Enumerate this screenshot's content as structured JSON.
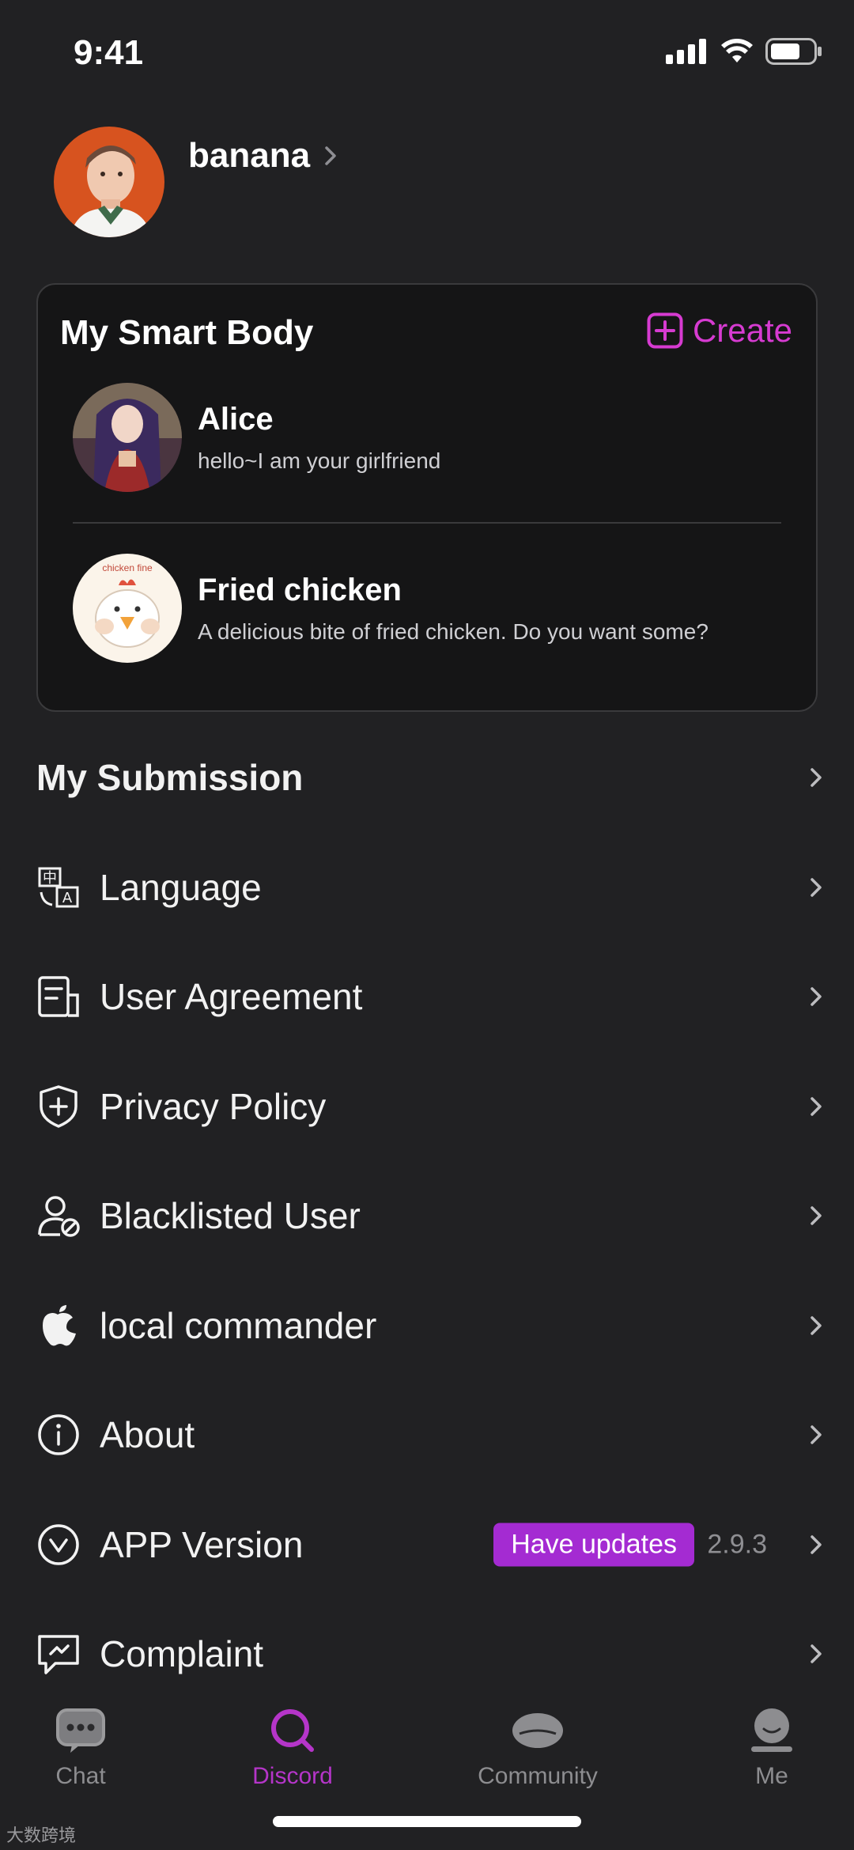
{
  "status_bar": {
    "time": "9:41"
  },
  "profile": {
    "name": "banana"
  },
  "smart_body": {
    "title": "My Smart Body",
    "create_label": "Create",
    "agents": [
      {
        "name": "Alice",
        "desc": "hello~I am your girlfriend"
      },
      {
        "name": "Fried chicken",
        "desc": "A delicious bite of fried chicken. Do you want some?",
        "avatar_text": "chicken fine"
      }
    ]
  },
  "menu": {
    "submission": "My Submission",
    "language": "Language",
    "user_agreement": "User Agreement",
    "privacy_policy": "Privacy Policy",
    "blacklisted_user": "Blacklisted User",
    "local_commander": "local commander",
    "about": "About",
    "app_version": "APP Version",
    "have_updates": "Have updates",
    "version_number": "2.9.3",
    "complaint": "Complaint"
  },
  "tabs": [
    {
      "label": "Chat",
      "icon": "chat-bubble-icon"
    },
    {
      "label": "Discord",
      "icon": "discover-search-icon",
      "active": true
    },
    {
      "label": "Community",
      "icon": "community-icon"
    },
    {
      "label": "Me",
      "icon": "me-icon"
    }
  ],
  "watermark": "大数跨境",
  "colors": {
    "accent": "#d63bd1",
    "badge": "#a42bd2",
    "background": "#212123"
  }
}
